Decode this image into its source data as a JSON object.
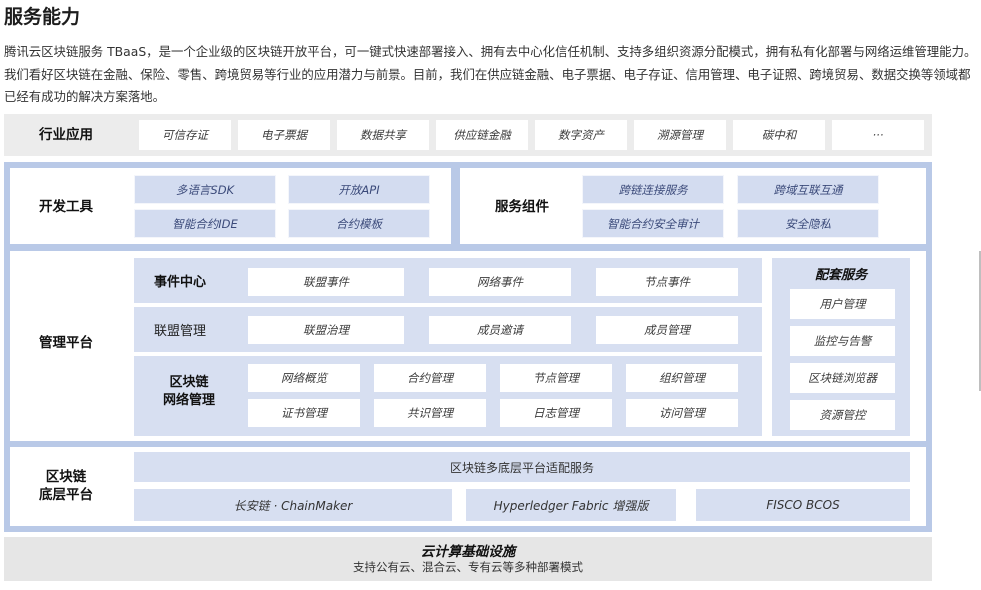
{
  "title": "服务能力",
  "intro": "腾讯云区块链服务 TBaaS，是一个企业级的区块链开放平台，可一键式快速部署接入、拥有去中心化信任机制、支持多组织资源分配模式，拥有私有化部署与网络运维管理能力。我们看好区块链在金融、保险、零售、跨境贸易等行业的应用潜力与前景。目前，我们在供应链金融、电子票据、电子存证、信用管理、电子证照、跨境贸易、数据交换等领域都已经有成功的解决方案落地。",
  "industry": {
    "label": "行业应用",
    "items": [
      "可信存证",
      "电子票据",
      "数据共享",
      "供应链金融",
      "数字资产",
      "溯源管理",
      "碳中和",
      "···"
    ]
  },
  "devtools": {
    "label": "开发工具",
    "items": [
      "多语言SDK",
      "开放API",
      "智能合约IDE",
      "合约模板"
    ]
  },
  "service_components": {
    "label": "服务组件",
    "items": [
      "跨链连接服务",
      "跨域互联互通",
      "智能合约安全审计",
      "安全隐私"
    ]
  },
  "management": {
    "label": "管理平台",
    "event_center": {
      "label": "事件中心",
      "items": [
        "联盟事件",
        "网络事件",
        "节点事件"
      ]
    },
    "alliance": {
      "label": "联盟管理",
      "items": [
        "联盟治理",
        "成员邀请",
        "成员管理"
      ]
    },
    "network": {
      "label_line1": "区块链",
      "label_line2": "网络管理",
      "items": [
        "网络概览",
        "合约管理",
        "节点管理",
        "组织管理",
        "证书管理",
        "共识管理",
        "日志管理",
        "访问管理"
      ]
    },
    "supporting": {
      "label": "配套服务",
      "items": [
        "用户管理",
        "监控与告警",
        "区块链浏览器",
        "资源管控"
      ]
    }
  },
  "base_platform": {
    "label_line1": "区块链",
    "label_line2": "底层平台",
    "adapter": "区块链多底层平台适配服务",
    "items": [
      "长安链 · ChainMaker",
      "Hyperledger Fabric 增强版",
      "FISCO BCOS"
    ]
  },
  "cloud": {
    "title": "云计算基础设施",
    "subtitle": "支持公有云、混合云、专有云等多种部署模式"
  }
}
